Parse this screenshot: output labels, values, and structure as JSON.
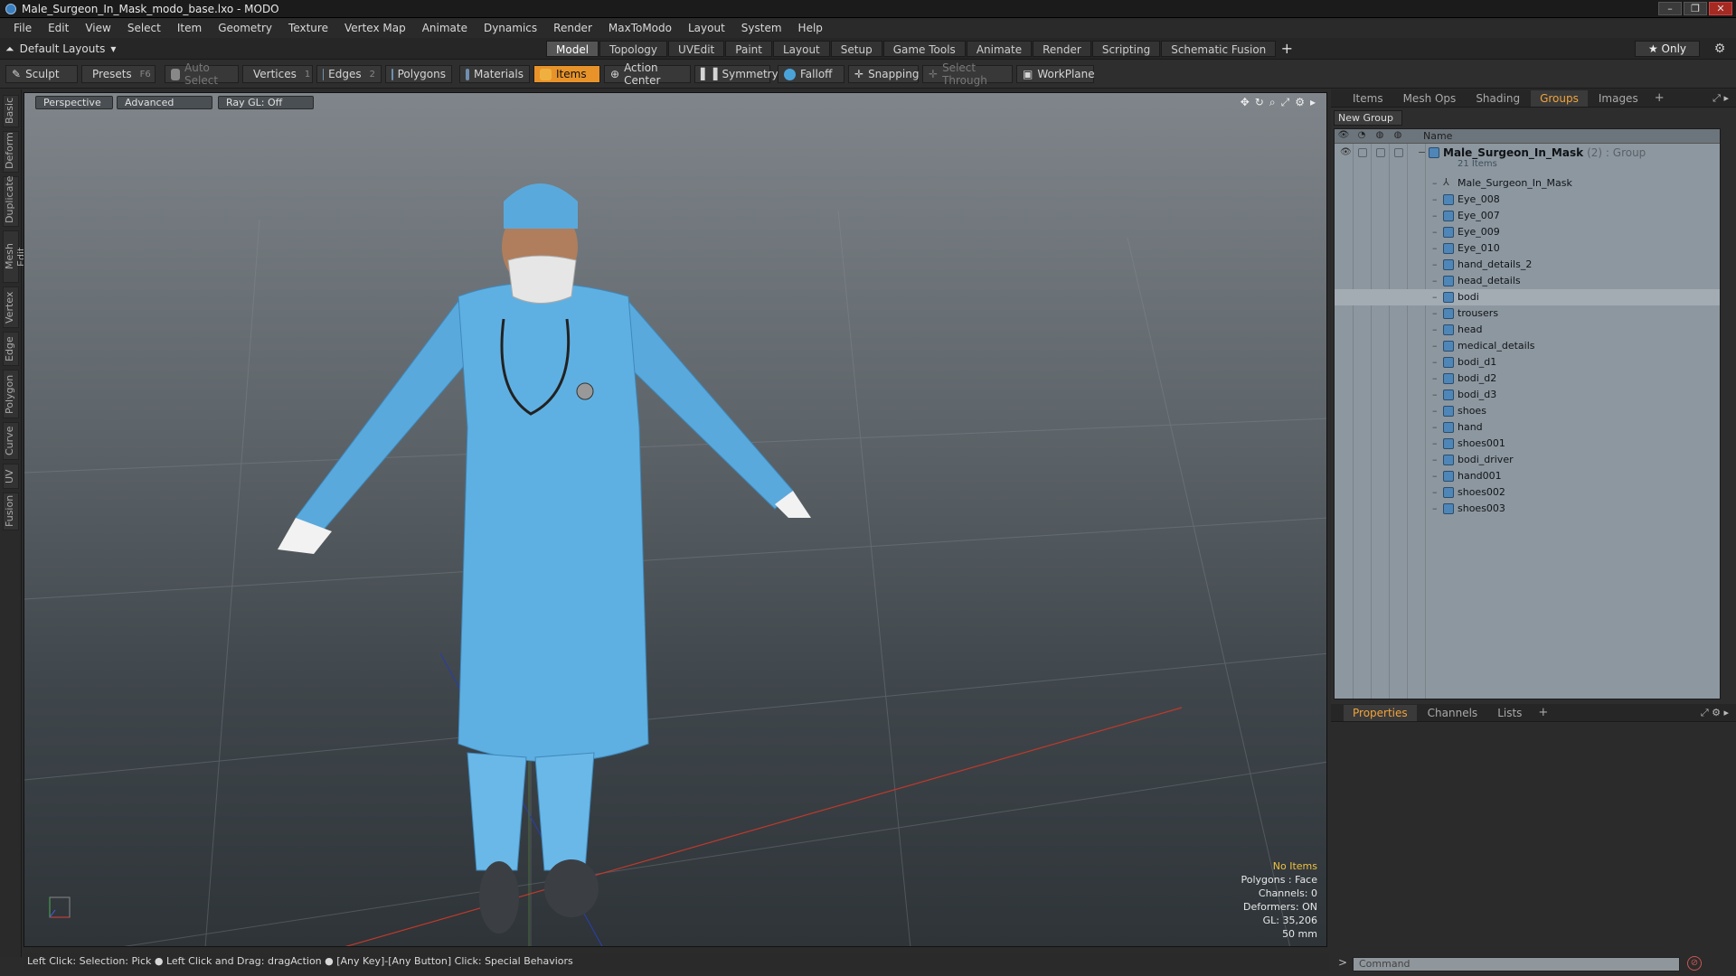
{
  "window": {
    "title": "Male_Surgeon_In_Mask_modo_base.lxo - MODO",
    "min": "–",
    "max": "❐",
    "close": "✕"
  },
  "menu": [
    "File",
    "Edit",
    "View",
    "Select",
    "Item",
    "Geometry",
    "Texture",
    "Vertex Map",
    "Animate",
    "Dynamics",
    "Render",
    "MaxToModo",
    "Layout",
    "System",
    "Help"
  ],
  "layout": {
    "selector": "Default Layouts",
    "tabs": [
      "Model",
      "Topology",
      "UVEdit",
      "Paint",
      "Layout",
      "Setup",
      "Game Tools",
      "Animate",
      "Render",
      "Scripting",
      "Schematic Fusion"
    ],
    "active_tab": "Model",
    "add": "+",
    "only": "★ Only"
  },
  "toolbar": {
    "sculpt": "Sculpt",
    "presets": "Presets",
    "presets_key": "F6",
    "auto_select": "Auto Select",
    "vertices": "Vertices",
    "vertices_key": "1",
    "edges": "Edges",
    "edges_key": "2",
    "polygons": "Polygons",
    "materials": "Materials",
    "items": "Items",
    "action_center": "Action Center",
    "symmetry": "Symmetry",
    "falloff": "Falloff",
    "snapping": "Snapping",
    "select_through": "Select Through",
    "workplane": "WorkPlane"
  },
  "left_tabs": [
    "Basic",
    "Deform",
    "Duplicate",
    "Mesh Edit",
    "Vertex",
    "Edge",
    "Polygon",
    "Curve",
    "UV",
    "Fusion"
  ],
  "viewport": {
    "view": "Perspective",
    "mode": "Advanced",
    "raygl": "Ray GL: Off",
    "hud": {
      "selection": "No Items",
      "polygons": "Polygons : Face",
      "channels": "Channels: 0",
      "deformers": "Deformers: ON",
      "gl": "GL: 35,206",
      "lens": "50 mm"
    }
  },
  "panel_top": {
    "tabs": [
      "Items",
      "Mesh Ops",
      "Shading",
      "Groups",
      "Images"
    ],
    "active": "Groups",
    "new_group": "New Group",
    "name_header": "Name",
    "root": {
      "name": "Male_Surgeon_In_Mask",
      "suffix": "(2) : Group",
      "count": "21 Items"
    },
    "items": [
      "Male_Surgeon_In_Mask",
      "Eye_008",
      "Eye_007",
      "Eye_009",
      "Eye_010",
      "hand_details_2",
      "head_details",
      "bodi",
      "trousers",
      "head",
      "medical_details",
      "bodi_d1",
      "bodi_d2",
      "bodi_d3",
      "shoes",
      "hand",
      "shoes001",
      "bodi_driver",
      "hand001",
      "shoes002",
      "shoes003"
    ]
  },
  "panel_bottom": {
    "tabs": [
      "Properties",
      "Channels",
      "Lists"
    ],
    "active": "Properties"
  },
  "command": {
    "placeholder": "Command"
  },
  "status": "Left Click: Selection: Pick ● Left Click and Drag: dragAction ● [Any Key]-[Any Button] Click: Special Behaviors"
}
